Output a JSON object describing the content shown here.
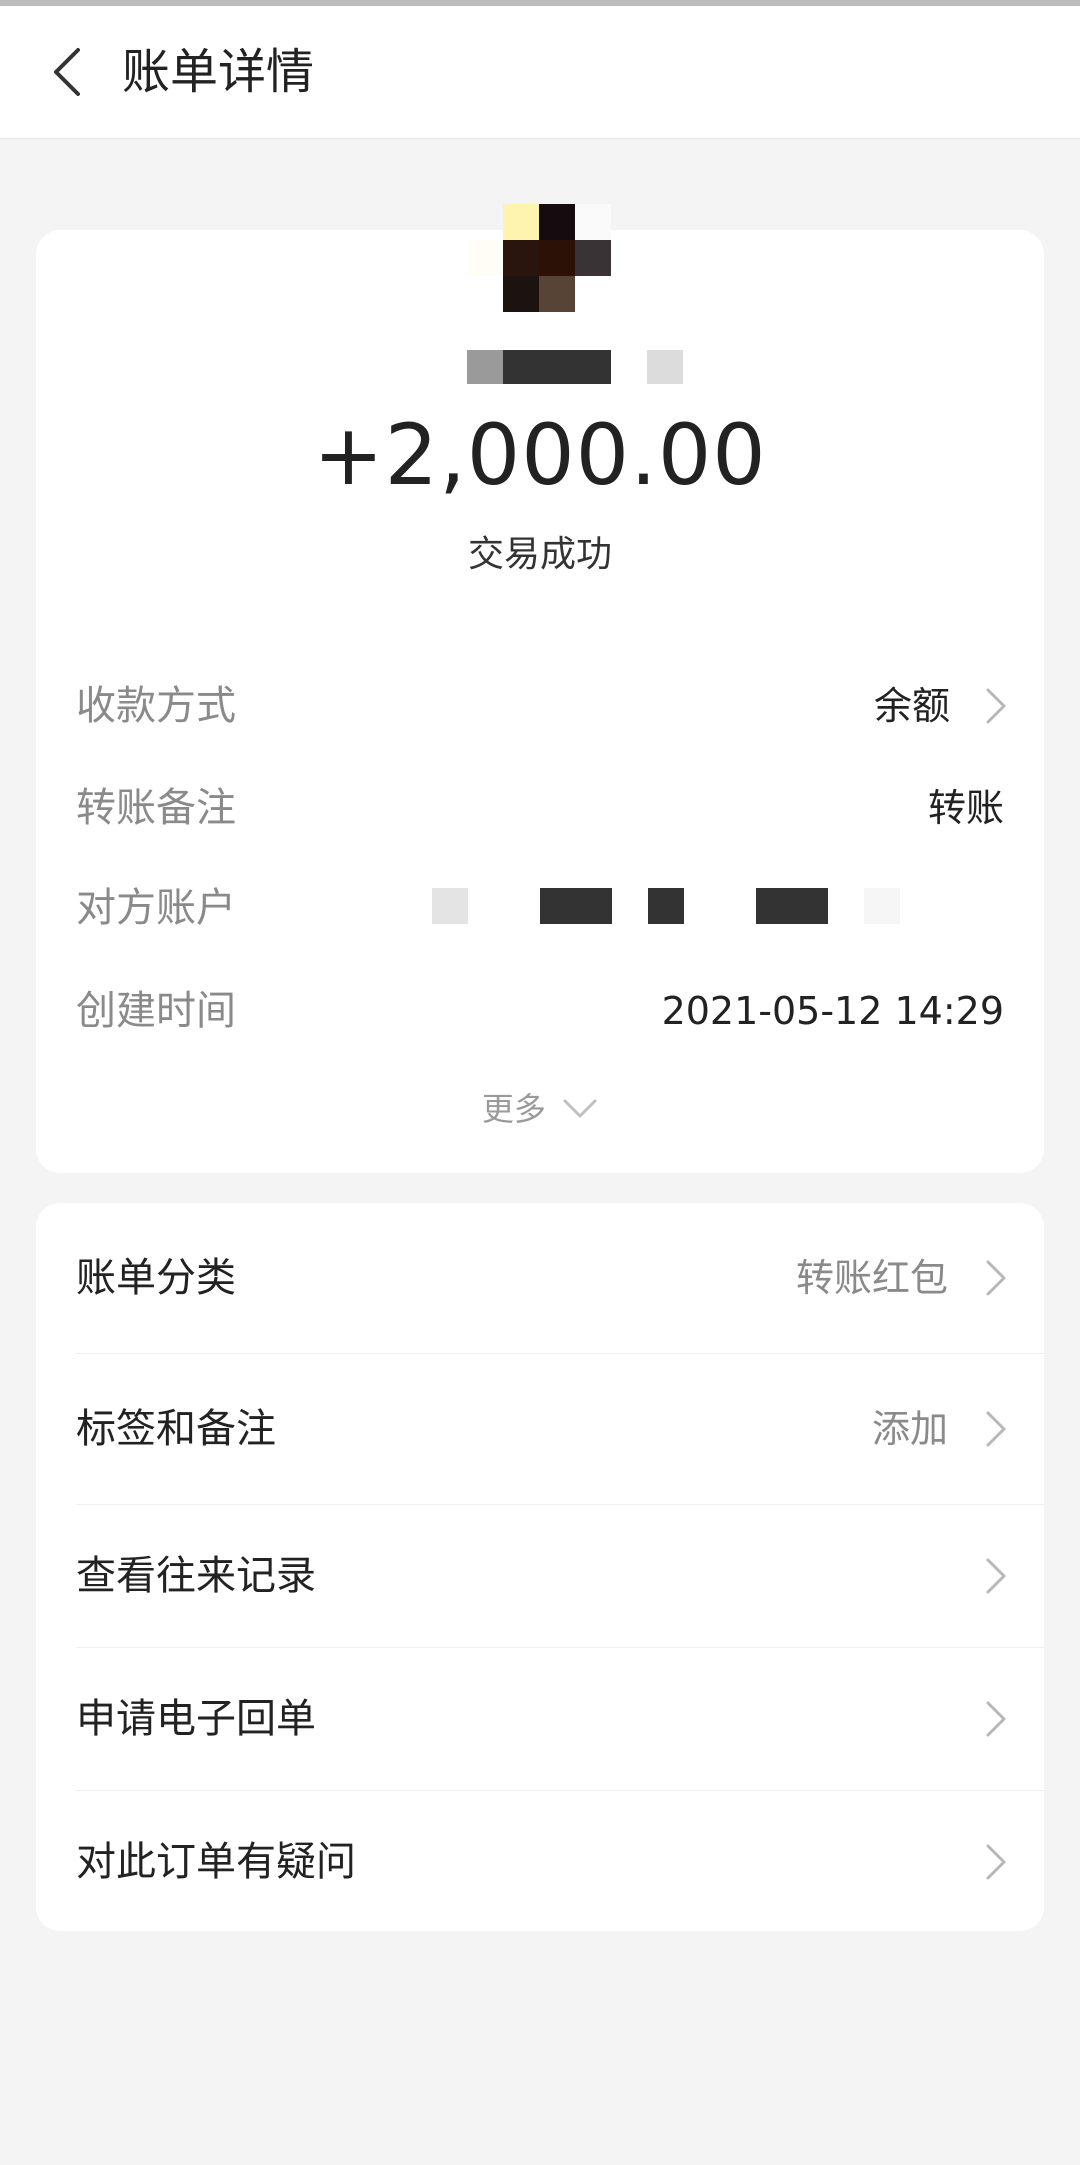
{
  "header": {
    "title": "账单详情"
  },
  "summary": {
    "amount": "+2,000.00",
    "status": "交易成功"
  },
  "details": [
    {
      "label": "收款方式",
      "value": "余额",
      "has_arrow": true
    },
    {
      "label": "转账备注",
      "value": "转账",
      "has_arrow": false
    },
    {
      "label": "对方账户",
      "value": "",
      "has_arrow": false
    },
    {
      "label": "创建时间",
      "value": "2021-05-12 14:29",
      "has_arrow": false
    }
  ],
  "more_label": "更多",
  "menu": [
    {
      "label": "账单分类",
      "value": "转账红包"
    },
    {
      "label": "标签和备注",
      "value": "添加"
    },
    {
      "label": "查看往来记录",
      "value": ""
    },
    {
      "label": "申请电子回单",
      "value": ""
    },
    {
      "label": "对此订单有疑问",
      "value": ""
    }
  ],
  "colors": {
    "background": "#f4f4f4",
    "card": "#ffffff",
    "primary_text": "#222222",
    "secondary_text": "#8a8a8a"
  }
}
